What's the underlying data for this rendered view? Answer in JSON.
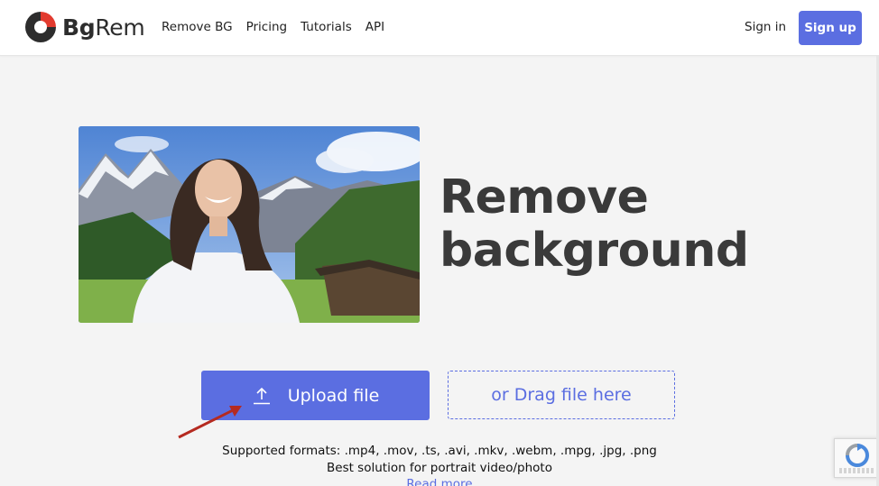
{
  "header": {
    "logo": {
      "bold": "Bg",
      "light": "Rem"
    },
    "nav": [
      "Remove BG",
      "Pricing",
      "Tutorials",
      "API"
    ],
    "sign_in": "Sign in",
    "sign_up": "Sign up"
  },
  "hero": {
    "title_line1": "Remove",
    "title_line2": "background",
    "image_icon": "woman-mountains-photo"
  },
  "upload": {
    "button_label": "Upload file",
    "button_icon": "upload-icon",
    "drag_label": "or Drag file here",
    "supported_formats": "Supported formats: .mp4, .mov, .ts, .avi, .mkv, .webm, .mpg, .jpg, .png",
    "best_solution": "Best solution for portrait video/photo",
    "read_more": "Read more"
  },
  "colors": {
    "accent": "#5b6ee1",
    "arrow": "#b52a20",
    "logo_red": "#e23b2f"
  }
}
